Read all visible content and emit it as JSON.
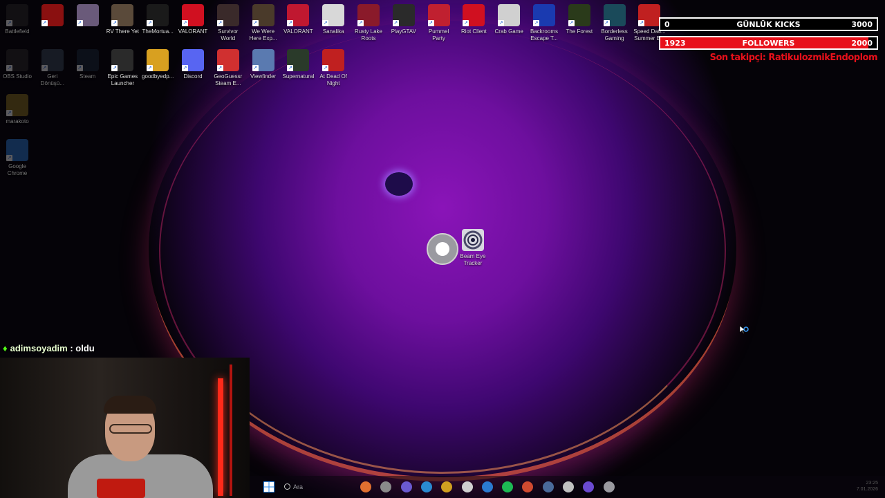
{
  "desktop": {
    "row1": [
      {
        "label": "Battlefield",
        "color": "#2a2a2a",
        "icon": "battlefield-icon",
        "dim": true
      },
      {
        "label": "",
        "color": "#8a1010",
        "icon": "red-game-icon",
        "dim": false
      },
      {
        "label": "",
        "color": "#6a5a7a",
        "icon": "anime-game-icon",
        "dim": false
      },
      {
        "label": "RV There Yet",
        "color": "#5a4a3a",
        "icon": "rv-there-yet-icon",
        "dim": false
      },
      {
        "label": "TheMortua...",
        "color": "#1a1a1a",
        "icon": "mortuary-icon",
        "dim": false
      },
      {
        "label": "VALORANT",
        "color": "#d01020",
        "icon": "riot-fist-icon",
        "dim": false
      },
      {
        "label": "Survivor World",
        "color": "#3a2a2a",
        "icon": "survivor-world-icon",
        "dim": false
      },
      {
        "label": "We Were Here Exp...",
        "color": "#4a3a2a",
        "icon": "we-were-here-icon",
        "dim": false
      },
      {
        "label": "VALORANT",
        "color": "#c01830",
        "icon": "valorant-icon",
        "dim": false
      },
      {
        "label": "Sanalika",
        "color": "#d8d8d8",
        "icon": "sanalika-icon",
        "dim": false
      },
      {
        "label": "Rusty Lake Roots",
        "color": "#8a1a2a",
        "icon": "rusty-lake-icon",
        "dim": false
      },
      {
        "label": "PlayGTAV",
        "color": "#2a2a2a",
        "icon": "gta-icon",
        "dim": false
      },
      {
        "label": "Pummel Party",
        "color": "#c02030",
        "icon": "pummel-party-icon",
        "dim": false
      },
      {
        "label": "Riot Client",
        "color": "#d01020",
        "icon": "riot-client-icon",
        "dim": false
      },
      {
        "label": "Crab Game",
        "color": "#d0d0d0",
        "icon": "crab-game-icon",
        "dim": false
      },
      {
        "label": "Backrooms Escape T...",
        "color": "#1a3ab0",
        "icon": "backrooms-icon",
        "dim": false
      },
      {
        "label": "The Forest",
        "color": "#2a3a1a",
        "icon": "the-forest-icon",
        "dim": false
      },
      {
        "label": "Borderless Gaming",
        "color": "#1a4a5a",
        "icon": "borderless-gaming-icon",
        "dim": false
      },
      {
        "label": "Speed Dati... Summer E...",
        "color": "#c02020",
        "icon": "speed-dating-icon",
        "dim": false
      }
    ],
    "row2": [
      {
        "label": "OBS Studio",
        "color": "#2a2a2a",
        "icon": "obs-icon",
        "dim": true
      },
      {
        "label": "Geri Dönüşü...",
        "color": "#3a4a5a",
        "icon": "recycle-bin-icon",
        "dim": true
      },
      {
        "label": "Steam",
        "color": "#1a2a3a",
        "icon": "steam-icon",
        "dim": true
      },
      {
        "label": "Epic Games Launcher",
        "color": "#2a2a2a",
        "icon": "epic-games-icon",
        "dim": false
      },
      {
        "label": "goodbyedp...",
        "color": "#d8a020",
        "icon": "folder-icon",
        "dim": false
      },
      {
        "label": "Discord",
        "color": "#5865f2",
        "icon": "discord-icon",
        "dim": false
      },
      {
        "label": "GeoGuessr Steam E...",
        "color": "#d03030",
        "icon": "geoguessr-icon",
        "dim": false
      },
      {
        "label": "Viewfinder",
        "color": "#5a7ab0",
        "icon": "viewfinder-icon",
        "dim": false
      },
      {
        "label": "Supernatural",
        "color": "#2a3a2a",
        "icon": "supernatural-icon",
        "dim": false
      },
      {
        "label": "At Dead Of Night",
        "color": "#c02020",
        "icon": "at-dead-of-night-icon",
        "dim": false
      }
    ],
    "col1_extra": [
      {
        "label": "marakoto",
        "color": "#8a7020",
        "icon": "folder-icon",
        "dim": true
      },
      {
        "label": "Google Chrome",
        "color": "#2a7ad0",
        "icon": "chrome-icon",
        "dim": true
      }
    ],
    "beam": {
      "label": "Beam Eye Tracker",
      "icon": "beam-eye-tracker-icon"
    }
  },
  "overlay": {
    "kicks": {
      "left": "0",
      "label": "GÜNLÜK KICKS",
      "right": "3000",
      "progress": 0
    },
    "followers": {
      "left": "1923",
      "label": "FOLLOWERS",
      "right": "2000",
      "progress": 0.9615
    },
    "last_follower": "Son takipçi: RatikulozmikEndoplom",
    "bar_color": "#e8101a"
  },
  "chat": {
    "user": "adimsoyadim",
    "separator": " : ",
    "message": "oldu"
  },
  "taskbar": {
    "search_placeholder": "Ara",
    "apps": [
      "start-icon",
      "search-icon",
      "app-icon",
      "task-view-icon",
      "copilot-icon",
      "edge-icon",
      "file-explorer-icon",
      "store-icon",
      "mail-icon",
      "spotify-icon",
      "chrome-icon",
      "steam-icon",
      "obs-icon",
      "app-icon",
      "settings-icon"
    ],
    "clock": "23:25",
    "date": "7.01.2026"
  }
}
